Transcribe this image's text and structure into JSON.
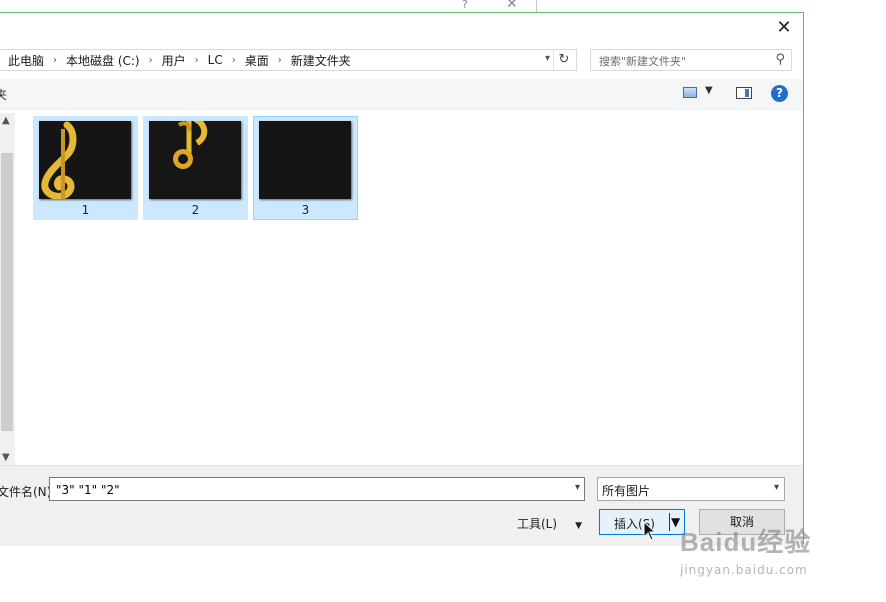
{
  "background_window": {
    "help_glyph": "?",
    "close_glyph": "✕"
  },
  "dialog": {
    "close_glyph": "✕",
    "breadcrumbs": [
      "此电脑",
      "本地磁盘 (C:)",
      "用户",
      "LC",
      "桌面",
      "新建文件夹"
    ],
    "breadcrumb_separator": "›",
    "refresh_glyph": "↻",
    "search": {
      "placeholder": "搜索\"新建文件夹\""
    },
    "toolbar": {
      "organize_partial": "夹",
      "help_glyph": "?"
    },
    "files": [
      {
        "name": "1"
      },
      {
        "name": "2"
      },
      {
        "name": "3"
      }
    ],
    "filename": {
      "label": "文件名(N):",
      "value": "\"3\" \"1\" \"2\""
    },
    "file_type": {
      "selected": "所有图片"
    },
    "tools_label": "工具(L)",
    "insert_label": "插入(S)",
    "cancel_label": "取消"
  },
  "watermark": {
    "brand": "Baidu经验",
    "url": "jingyan.baidu.com"
  },
  "colors": {
    "selection": "#cce8ff",
    "accent": "#0078d7",
    "border_green": "#6bb36b"
  }
}
